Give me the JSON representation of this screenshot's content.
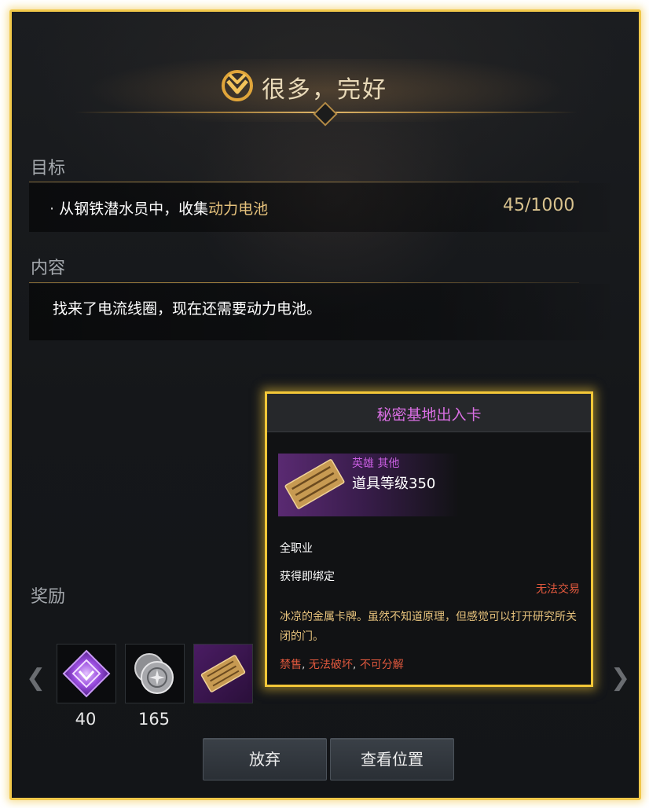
{
  "quest": {
    "title": "很多，完好",
    "objective_label": "目标",
    "objective": {
      "prefix": "从钢铁潜水员中，收集",
      "highlight": "动力电池",
      "progress": "45/1000"
    },
    "content_label": "内容",
    "content_text": "找来了电流线圈，现在还需要动力电池。",
    "reward_label": "奖励",
    "rewards": [
      {
        "icon": "purple-crystal-icon",
        "count": "40"
      },
      {
        "icon": "silver-coin-stack-icon",
        "count": "165"
      },
      {
        "icon": "secret-base-card-icon",
        "count": ""
      }
    ],
    "buttons": {
      "abandon": "放弃",
      "locate": "查看位置"
    }
  },
  "tooltip": {
    "title": "秘密基地出入卡",
    "rarity": "英雄 其他",
    "item_level": "道具等级350",
    "class": "全职业",
    "bind": "获得即绑定",
    "trade": "无法交易",
    "description": "冰凉的金属卡牌。虽然不知道原理，但感觉可以打开研究所关闭的门。",
    "flags": [
      "禁售",
      "无法破坏",
      "不可分解"
    ],
    "flag_separator": ", "
  },
  "colors": {
    "frame_highlight": "#f1c84a",
    "rarity_hero": "#c85ee0",
    "item_gold": "#e6c27c",
    "warning_red": "#e0583d"
  }
}
